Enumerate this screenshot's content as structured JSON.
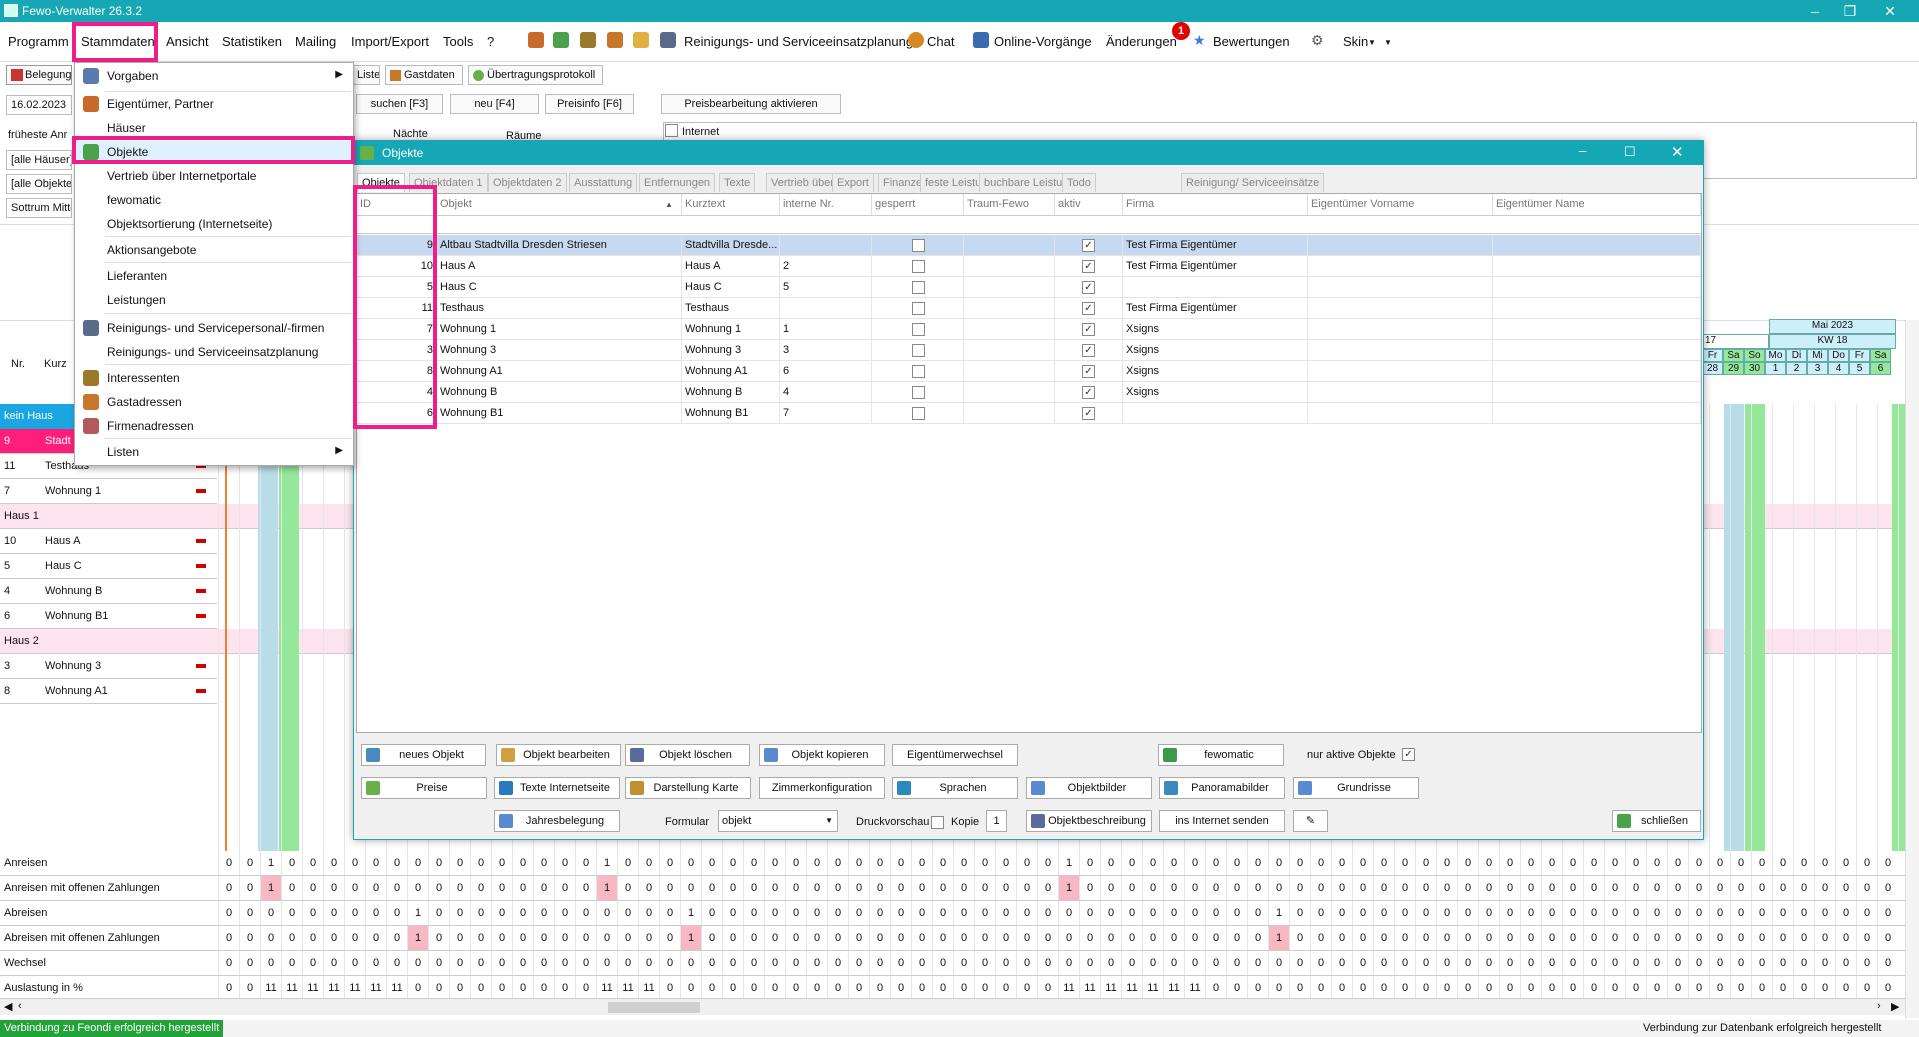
{
  "app": {
    "title": "Fewo-Verwalter 26.3.2"
  },
  "menubar": {
    "items": [
      "Programm",
      "Stammdaten",
      "Ansicht",
      "Statistiken",
      "Mailing",
      "Import/Export",
      "Tools",
      "?"
    ],
    "reinigung": "Reinigungs- und Serviceeinsatzplanung",
    "chat": "Chat",
    "online": "Online-Vorgänge",
    "aenderungen": "Änderungen",
    "aenderungen_badge": "1",
    "bewertungen": "Bewertungen",
    "skin": "Skin"
  },
  "left": {
    "belegung": "Belegung",
    "date": "16.02.2023",
    "frueheste": "früheste Anr",
    "alle_haeuser": "[alle Häuser]",
    "alle_objekte": "[alle Objekte]",
    "sottrum": "Sottrum Mitte",
    "col_nr": "Nr.",
    "col_kurz": "Kurz",
    "kein_haus": "kein Haus",
    "rows": [
      {
        "nr": "9",
        "kurz": "Stadt"
      },
      {
        "nr": "11",
        "kurz": "Testhaus"
      },
      {
        "nr": "7",
        "kurz": "Wohnung 1"
      },
      {
        "group": "Haus 1"
      },
      {
        "nr": "10",
        "kurz": "Haus A"
      },
      {
        "nr": "5",
        "kurz": "Haus C"
      },
      {
        "nr": "4",
        "kurz": "Wohnung B"
      },
      {
        "nr": "6",
        "kurz": "Wohnung B1"
      },
      {
        "group": "Haus 2"
      },
      {
        "nr": "3",
        "kurz": "Wohnung 3"
      },
      {
        "nr": "8",
        "kurz": "Wohnung A1"
      }
    ]
  },
  "toolbar2": {
    "liste": "Liste",
    "gastdaten": "Gastdaten",
    "uebertragung": "Übertragungsprotokoll",
    "suchen": "suchen [F3]",
    "neu": "neu [F4]",
    "preisinfo": "Preisinfo [F6]",
    "preisbearbeitung": "Preisbearbeitung aktivieren",
    "naechte": "Nächte",
    "raeume": "Räume",
    "internet": "Internet"
  },
  "dropdown": {
    "items": [
      {
        "label": "Vorgaben",
        "arrow": true
      },
      {
        "label": "Eigentümer, Partner"
      },
      {
        "label": "Häuser"
      },
      {
        "label": "Objekte"
      },
      {
        "label": "Vertrieb über Internetportale"
      },
      {
        "label": "fewomatic"
      },
      {
        "label": "Objektsortierung (Internetseite)"
      },
      {
        "label": "Aktionsangebote"
      },
      {
        "label": "Lieferanten"
      },
      {
        "label": "Leistungen"
      },
      {
        "label": "Reinigungs- und Servicepersonal/-firmen"
      },
      {
        "label": "Reinigungs- und Serviceeinsatzplanung"
      },
      {
        "label": "Interessenten"
      },
      {
        "label": "Gastadressen"
      },
      {
        "label": "Firmenadressen"
      },
      {
        "label": "Listen",
        "arrow": true
      }
    ]
  },
  "dialog": {
    "title": "Objekte",
    "tabs": [
      "Objekte",
      "Objektdaten 1",
      "Objektdaten 2",
      "Ausstattung",
      "Entfernungen",
      "Texte",
      "Vertrieb über Internet",
      "Export",
      "Finanzen",
      "feste Leistungen",
      "buchbare Leistungen",
      "Todo",
      "Reinigung/ Serviceeinsätze"
    ],
    "columns": [
      "ID",
      "Objekt",
      "Kurztext",
      "interne Nr.",
      "gesperrt",
      "Traum-Fewo",
      "aktiv",
      "Firma",
      "Eigentümer Vorname",
      "Eigentümer Name"
    ],
    "rows": [
      {
        "id": "9",
        "objekt": "Altbau Stadtvilla Dresden Striesen",
        "kurz": "Stadtvilla Dresde...",
        "intern": "",
        "firma": "Test Firma Eigentümer"
      },
      {
        "id": "10",
        "objekt": "Haus A",
        "kurz": "Haus A",
        "intern": "2",
        "firma": "Test Firma Eigentümer"
      },
      {
        "id": "5",
        "objekt": "Haus C",
        "kurz": "Haus C",
        "intern": "5",
        "firma": ""
      },
      {
        "id": "11",
        "objekt": "Testhaus",
        "kurz": "Testhaus",
        "intern": "",
        "firma": "Test Firma Eigentümer"
      },
      {
        "id": "7",
        "objekt": "Wohnung 1",
        "kurz": "Wohnung 1",
        "intern": "1",
        "firma": "Xsigns"
      },
      {
        "id": "3",
        "objekt": "Wohnung 3",
        "kurz": "Wohnung 3",
        "intern": "3",
        "firma": "Xsigns"
      },
      {
        "id": "8",
        "objekt": "Wohnung A1",
        "kurz": "Wohnung A1",
        "intern": "6",
        "firma": "Xsigns"
      },
      {
        "id": "4",
        "objekt": "Wohnung B",
        "kurz": "Wohnung B",
        "intern": "4",
        "firma": "Xsigns"
      },
      {
        "id": "6",
        "objekt": "Wohnung B1",
        "kurz": "Wohnung B1",
        "intern": "7",
        "firma": ""
      }
    ],
    "buttons": {
      "neues_objekt": "neues Objekt",
      "objekt_bearbeiten": "Objekt bearbeiten",
      "objekt_loeschen": "Objekt löschen",
      "objekt_kopieren": "Objekt kopieren",
      "eigentuemerwechsel": "Eigentümerwechsel",
      "fewomatic": "fewomatic",
      "nur_aktive": "nur aktive Objekte",
      "preise": "Preise",
      "texte_internetseite": "Texte Internetseite",
      "darstellung_karte": "Darstellung Karte",
      "zimmerkonfiguration": "Zimmerkonfiguration",
      "sprachen": "Sprachen",
      "objektbilder": "Objektbilder",
      "panoramabilder": "Panoramabilder",
      "grundrisse": "Grundrisse",
      "jahresbelegung": "Jahresbelegung",
      "formular_label": "Formular",
      "formular_value": "objekt",
      "druckvorschau": "Druckvorschau",
      "kopie_label": "Kopie",
      "kopie_value": "1",
      "objektbeschreibung": "Objektbeschreibung",
      "ins_internet": "ins Internet senden",
      "schliessen": "schließen"
    }
  },
  "calendar": {
    "month": "Mai 2023",
    "kw": "KW 18",
    "kw_prev": "17",
    "days": [
      "Fr",
      "Sa",
      "So",
      "Mo",
      "Di",
      "Mi",
      "Do",
      "Fr",
      "Sa"
    ],
    "dates": [
      "28",
      "29",
      "30",
      "1",
      "2",
      "3",
      "4",
      "5",
      "6"
    ]
  },
  "stats": {
    "rows": [
      {
        "label": "Anreisen",
        "values": [
          "0",
          "0",
          "1",
          "0",
          "0",
          "0",
          "0",
          "0",
          "0",
          "0",
          "0",
          "0",
          "0",
          "0",
          "0",
          "0",
          "0",
          "0",
          "1",
          "0",
          "0",
          "0",
          "0",
          "0",
          "0",
          "0",
          "0",
          "0",
          "0",
          "0",
          "0",
          "0",
          "0",
          "0",
          "0",
          "0",
          "0",
          "0",
          "0",
          "0",
          "1",
          "0",
          "0",
          "0",
          "0",
          "0",
          "0",
          "0",
          "0",
          "0",
          "0",
          "0",
          "0",
          "0",
          "0",
          "0",
          "0",
          "0",
          "0",
          "0",
          "0",
          "0",
          "0",
          "0",
          "0",
          "0",
          "0",
          "0",
          "0",
          "0",
          "0",
          "0",
          "0",
          "0",
          "0",
          "0",
          "0",
          "0",
          "0",
          "0",
          "0"
        ]
      },
      {
        "label": "Anreisen mit offenen Zahlungen",
        "values": [
          "0",
          "0",
          "1",
          "0",
          "0",
          "0",
          "0",
          "0",
          "0",
          "0",
          "0",
          "0",
          "0",
          "0",
          "0",
          "0",
          "0",
          "0",
          "1",
          "0",
          "0",
          "0",
          "0",
          "0",
          "0",
          "0",
          "0",
          "0",
          "0",
          "0",
          "0",
          "0",
          "0",
          "0",
          "0",
          "0",
          "0",
          "0",
          "0",
          "0",
          "1",
          "0",
          "0",
          "0",
          "0",
          "0",
          "0",
          "0",
          "0",
          "0",
          "0",
          "0",
          "0",
          "0",
          "0",
          "0",
          "0",
          "0",
          "0",
          "0",
          "0",
          "0",
          "0",
          "0",
          "0",
          "0",
          "0",
          "0",
          "0",
          "0",
          "0",
          "0",
          "0",
          "0",
          "0",
          "0",
          "0",
          "0",
          "0",
          "0",
          "0"
        ]
      },
      {
        "label": "Abreisen",
        "values": [
          "0",
          "0",
          "0",
          "0",
          "0",
          "0",
          "0",
          "0",
          "0",
          "1",
          "0",
          "0",
          "0",
          "0",
          "0",
          "0",
          "0",
          "0",
          "0",
          "0",
          "0",
          "0",
          "1",
          "0",
          "0",
          "0",
          "0",
          "0",
          "0",
          "0",
          "0",
          "0",
          "0",
          "0",
          "0",
          "0",
          "0",
          "0",
          "0",
          "0",
          "0",
          "0",
          "0",
          "0",
          "0",
          "0",
          "0",
          "0",
          "0",
          "0",
          "1",
          "0",
          "0",
          "0",
          "0",
          "0",
          "0",
          "0",
          "0",
          "0",
          "0",
          "0",
          "0",
          "0",
          "0",
          "0",
          "0",
          "0",
          "0",
          "0",
          "0",
          "0",
          "0",
          "0",
          "0",
          "0",
          "0",
          "0",
          "0",
          "0",
          "0"
        ]
      },
      {
        "label": "Abreisen mit offenen Zahlungen",
        "values": [
          "0",
          "0",
          "0",
          "0",
          "0",
          "0",
          "0",
          "0",
          "0",
          "1",
          "0",
          "0",
          "0",
          "0",
          "0",
          "0",
          "0",
          "0",
          "0",
          "0",
          "0",
          "0",
          "1",
          "0",
          "0",
          "0",
          "0",
          "0",
          "0",
          "0",
          "0",
          "0",
          "0",
          "0",
          "0",
          "0",
          "0",
          "0",
          "0",
          "0",
          "0",
          "0",
          "0",
          "0",
          "0",
          "0",
          "0",
          "0",
          "0",
          "0",
          "1",
          "0",
          "0",
          "0",
          "0",
          "0",
          "0",
          "0",
          "0",
          "0",
          "0",
          "0",
          "0",
          "0",
          "0",
          "0",
          "0",
          "0",
          "0",
          "0",
          "0",
          "0",
          "0",
          "0",
          "0",
          "0",
          "0",
          "0",
          "0",
          "0",
          "0"
        ]
      },
      {
        "label": "Wechsel",
        "values": [
          "0",
          "0",
          "0",
          "0",
          "0",
          "0",
          "0",
          "0",
          "0",
          "0",
          "0",
          "0",
          "0",
          "0",
          "0",
          "0",
          "0",
          "0",
          "0",
          "0",
          "0",
          "0",
          "0",
          "0",
          "0",
          "0",
          "0",
          "0",
          "0",
          "0",
          "0",
          "0",
          "0",
          "0",
          "0",
          "0",
          "0",
          "0",
          "0",
          "0",
          "0",
          "0",
          "0",
          "0",
          "0",
          "0",
          "0",
          "0",
          "0",
          "0",
          "0",
          "0",
          "0",
          "0",
          "0",
          "0",
          "0",
          "0",
          "0",
          "0",
          "0",
          "0",
          "0",
          "0",
          "0",
          "0",
          "0",
          "0",
          "0",
          "0",
          "0",
          "0",
          "0",
          "0",
          "0",
          "0",
          "0",
          "0",
          "0",
          "0",
          "0"
        ]
      },
      {
        "label": "Auslastung in %",
        "values": [
          "0",
          "0",
          "11",
          "11",
          "11",
          "11",
          "11",
          "11",
          "11",
          "0",
          "0",
          "0",
          "0",
          "0",
          "0",
          "0",
          "0",
          "0",
          "11",
          "11",
          "11",
          "0",
          "0",
          "0",
          "0",
          "0",
          "0",
          "0",
          "0",
          "0",
          "0",
          "0",
          "0",
          "0",
          "0",
          "0",
          "0",
          "0",
          "0",
          "0",
          "11",
          "11",
          "11",
          "11",
          "11",
          "11",
          "11",
          "0",
          "0",
          "0",
          "0",
          "0",
          "0",
          "0",
          "0",
          "0",
          "0",
          "0",
          "0",
          "0",
          "0",
          "0",
          "0",
          "0",
          "0",
          "0",
          "0",
          "0",
          "0",
          "0",
          "0",
          "0",
          "0",
          "0",
          "0",
          "0",
          "0",
          "0",
          "0",
          "0",
          "0"
        ]
      }
    ]
  },
  "status": {
    "left": "Verbindung zu Feondi erfolgreich hergestellt",
    "right": "Verbindung zur Datenbank erfolgreich hergestellt"
  }
}
